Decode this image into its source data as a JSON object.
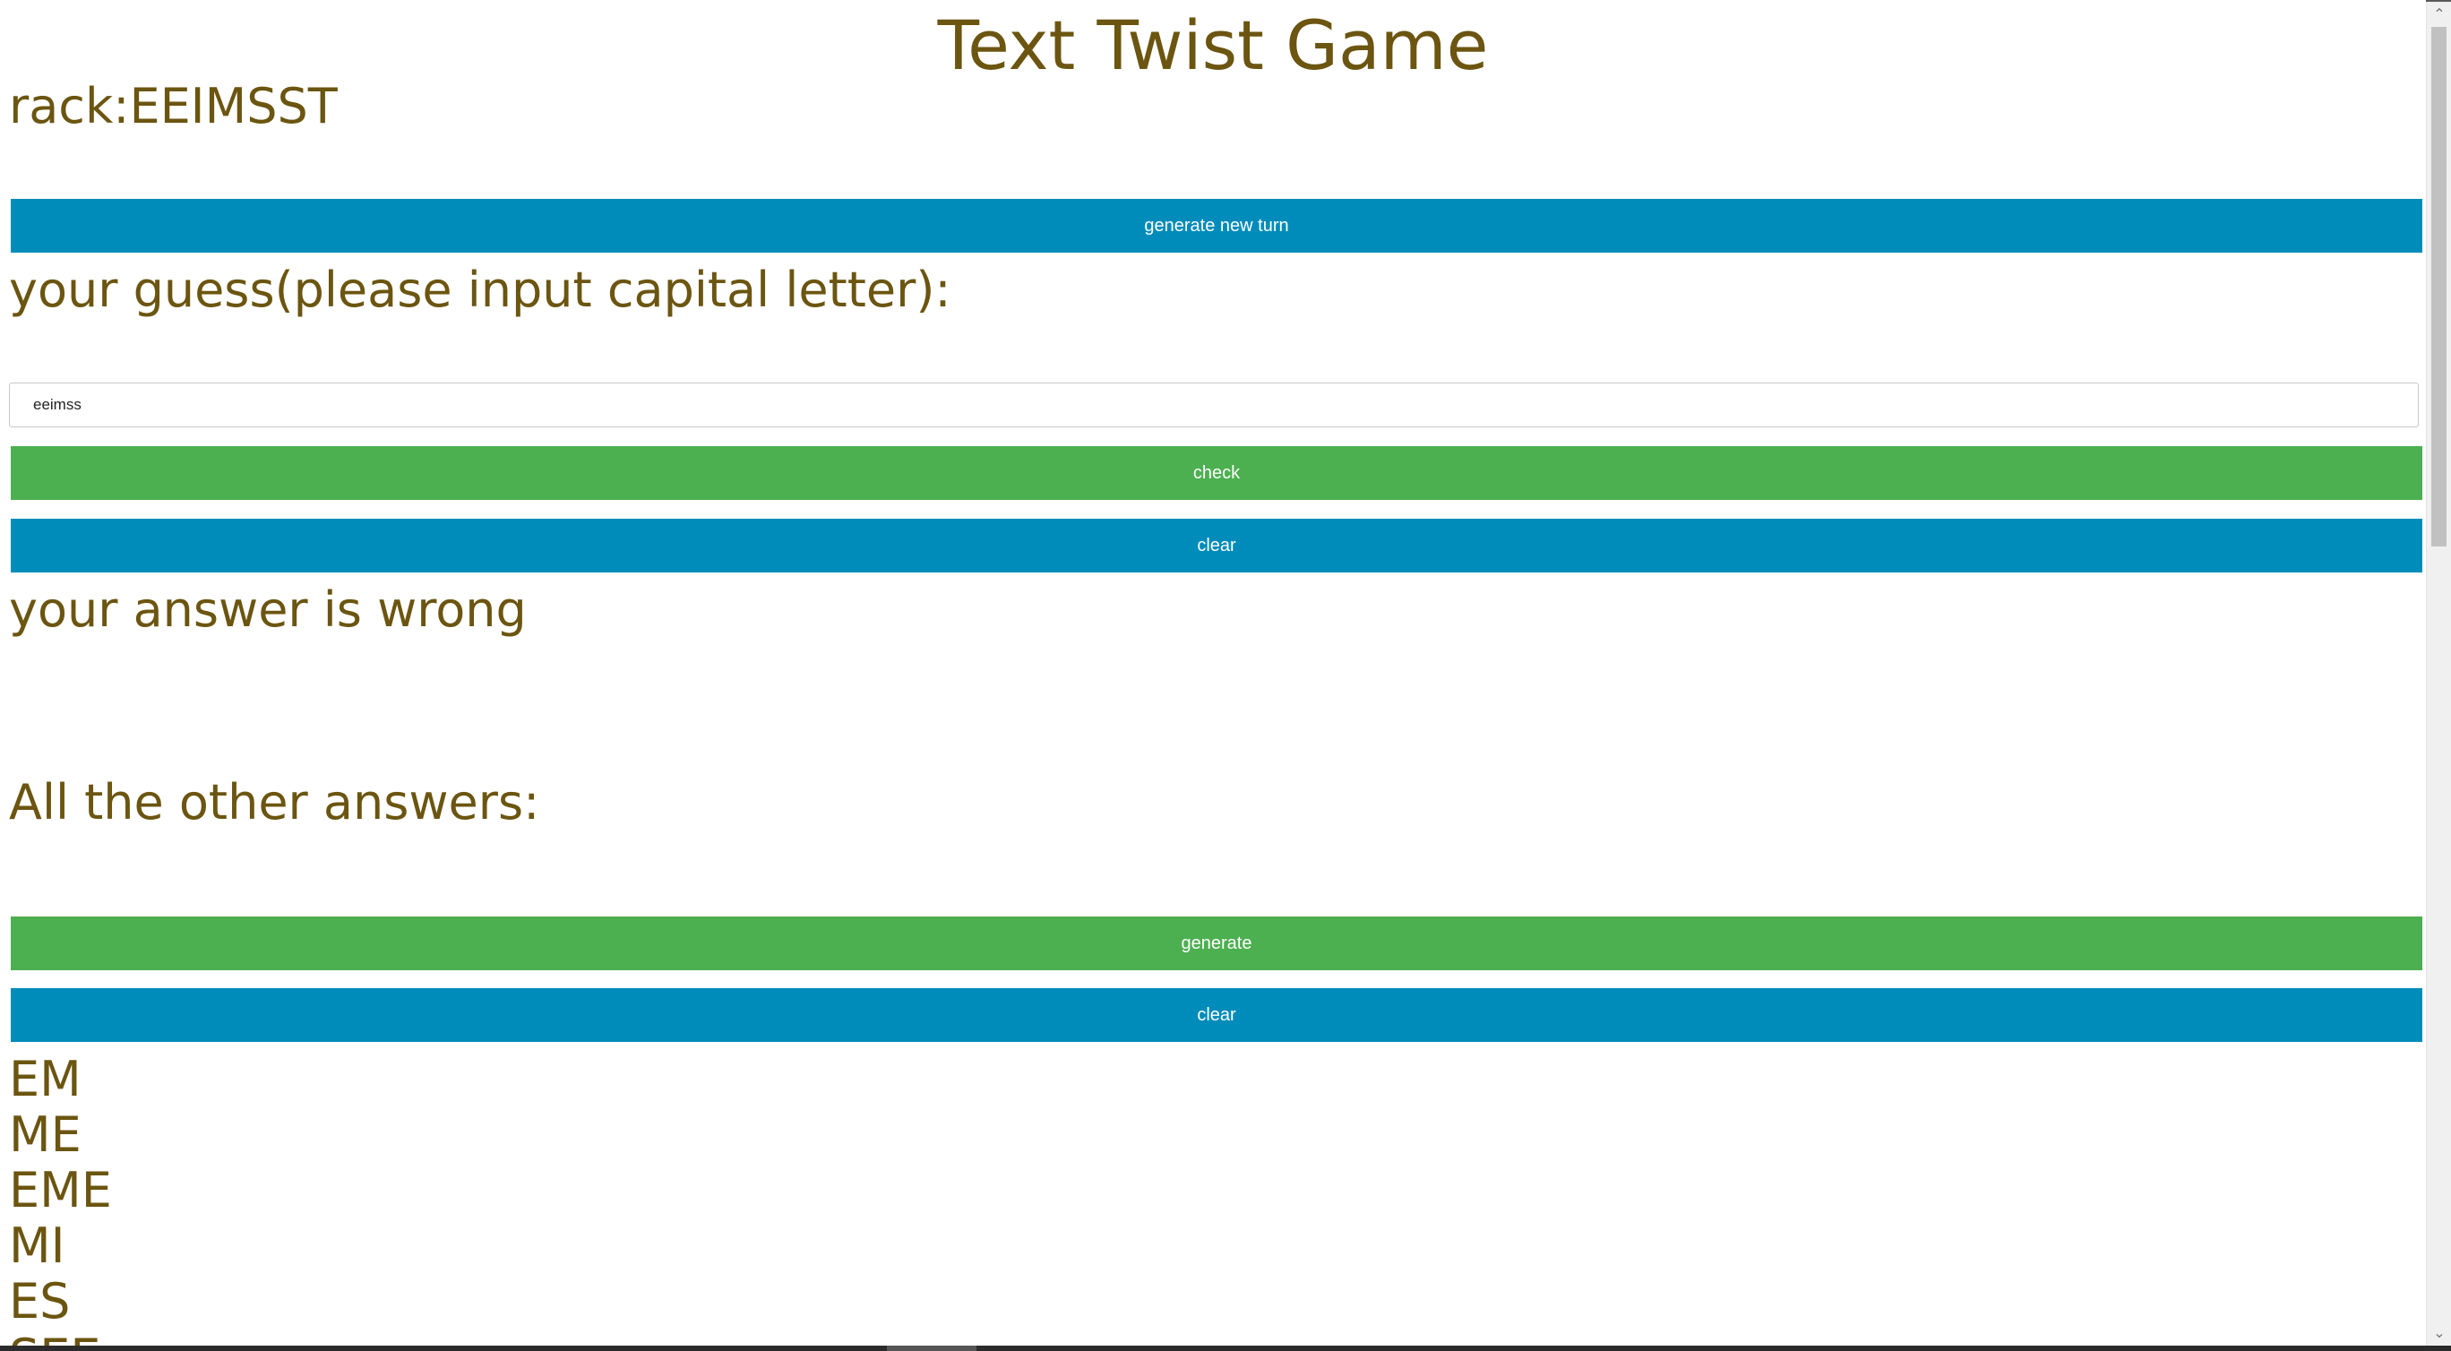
{
  "page": {
    "title": "Text Twist Game",
    "rack_label": "rack:EEIMSST",
    "new_turn_button": "generate new turn",
    "guess_label": "your guess(please input capital letter):",
    "guess_input_value": "eeimss",
    "check_button": "check",
    "clear_guess_button": "clear",
    "result_message": "your answer is wrong",
    "other_answers_label": "All the other answers:",
    "generate_button": "generate",
    "clear_answers_button": "clear",
    "answers": [
      "EM",
      "ME",
      "EME",
      "MI",
      "ES",
      "SEE"
    ]
  },
  "colors": {
    "text": "#6b5510",
    "blue_button": "#008cba",
    "green_button": "#4caf50"
  },
  "scrollbar": {
    "up_icon": "chevron-up-icon",
    "down_icon": "chevron-down-icon"
  }
}
